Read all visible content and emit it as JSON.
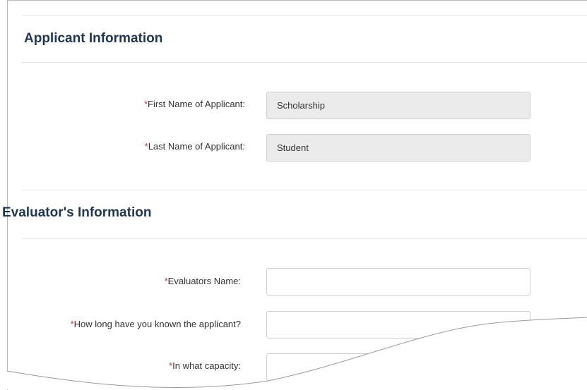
{
  "sections": {
    "applicant": {
      "title": "Applicant Information"
    },
    "evaluator": {
      "title": "Evaluator's Information"
    }
  },
  "required_mark": "*",
  "fields": {
    "first_name": {
      "label": "First Name of Applicant:",
      "value": "Scholarship"
    },
    "last_name": {
      "label": "Last Name of Applicant:",
      "value": "Student"
    },
    "evaluator_name": {
      "label": "Evaluators Name:",
      "value": ""
    },
    "known_duration": {
      "label": "How long have you known the applicant?",
      "value": ""
    },
    "capacity": {
      "label": "In what capacity:",
      "value": ""
    }
  }
}
